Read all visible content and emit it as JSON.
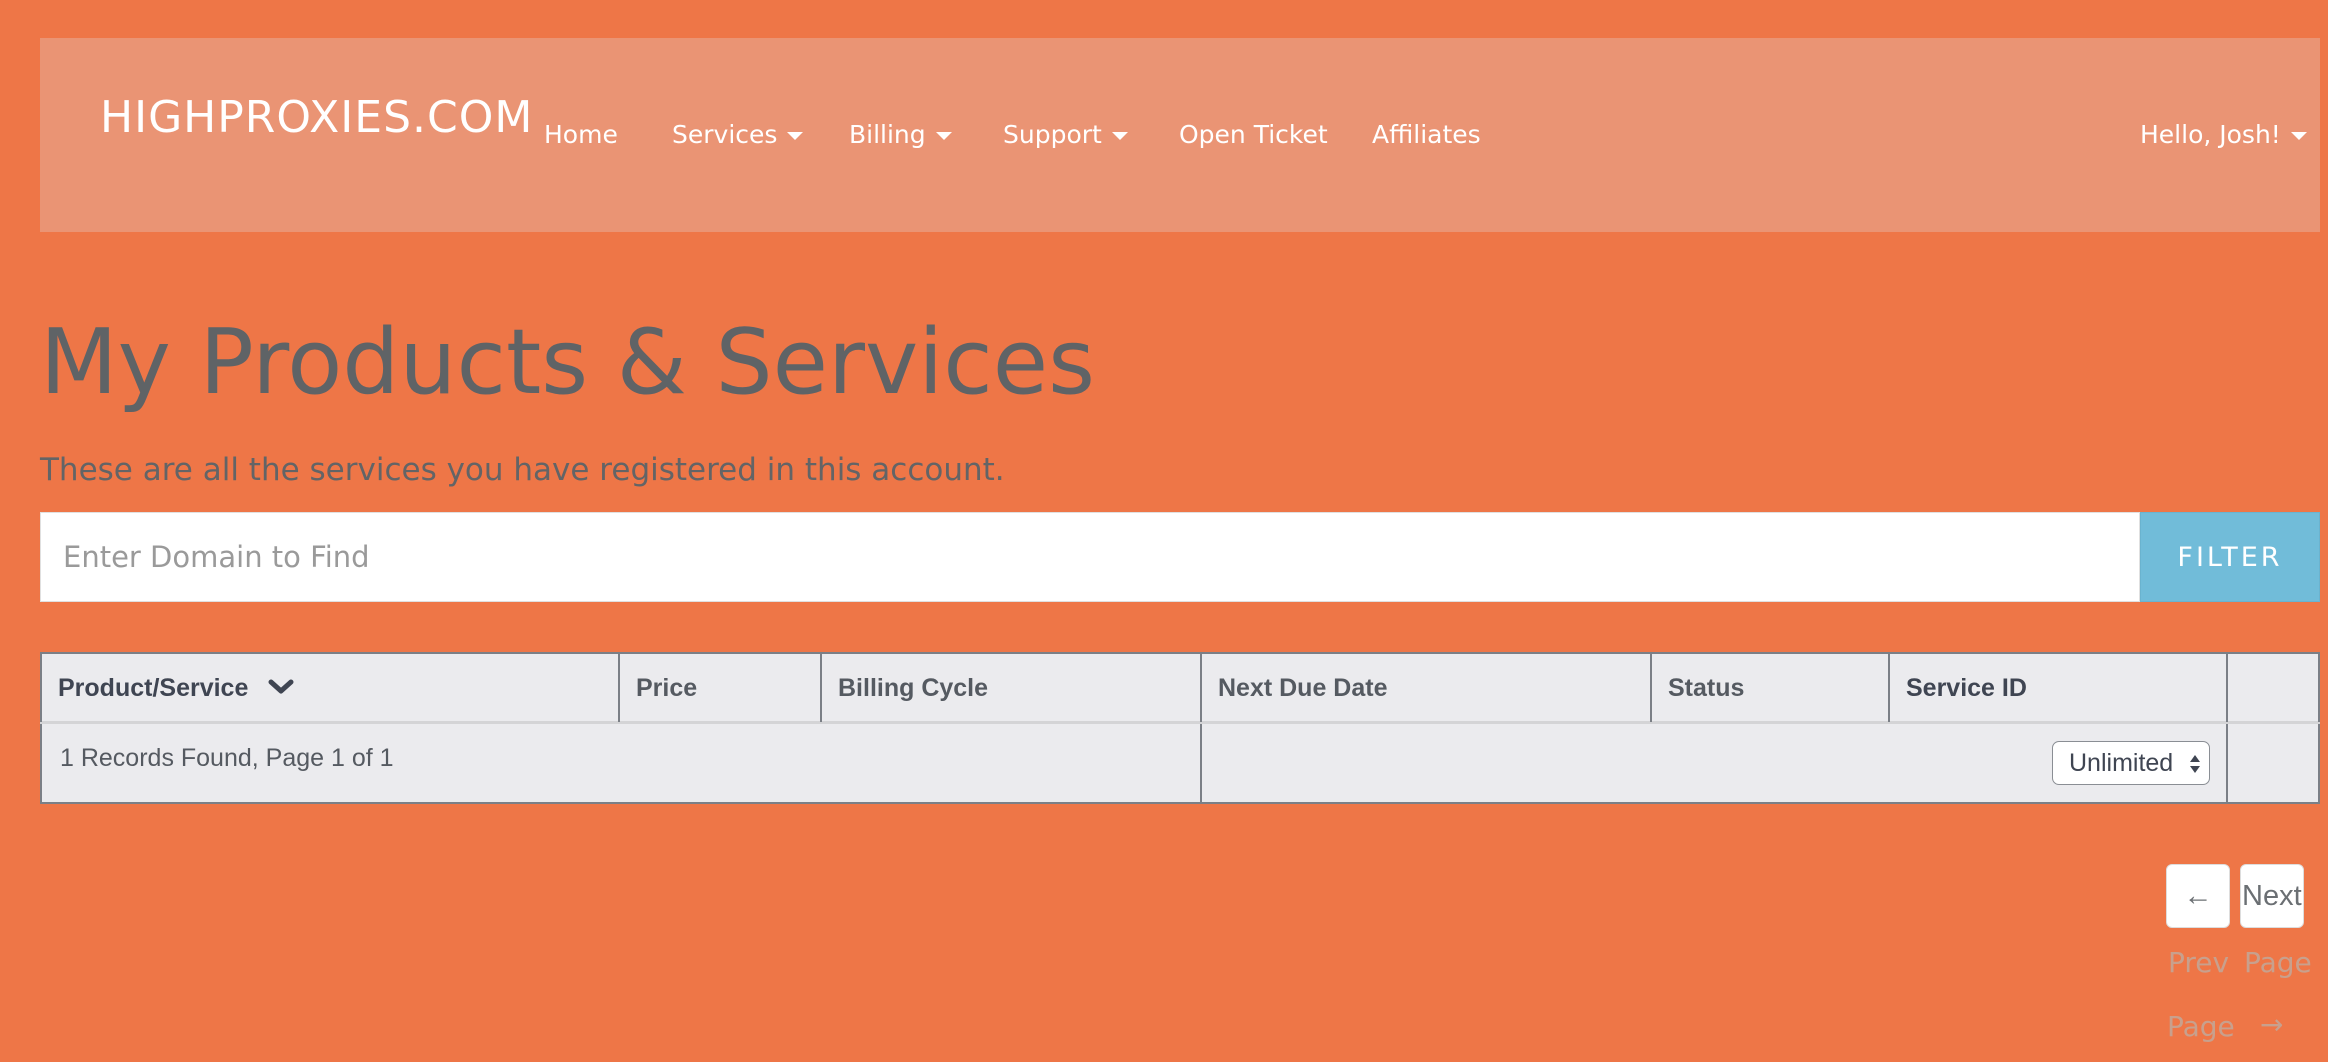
{
  "header": {
    "brand": "HIGHPROXIES.COM",
    "nav": [
      {
        "label": "Home",
        "dropdown": false
      },
      {
        "label": "Services",
        "dropdown": true
      },
      {
        "label": "Billing",
        "dropdown": true
      },
      {
        "label": "Support",
        "dropdown": true
      },
      {
        "label": "Open Ticket",
        "dropdown": false
      },
      {
        "label": "Affiliates",
        "dropdown": false
      }
    ],
    "user_menu": "Hello, Josh!"
  },
  "main": {
    "title": "My Products & Services",
    "subtitle": "These are all the services you have registered in this account.",
    "search": {
      "placeholder": "Enter Domain to Find",
      "value": ""
    },
    "filter_label": "FILTER"
  },
  "table": {
    "columns": [
      "Product/Service",
      "Price",
      "Billing Cycle",
      "Next Due Date",
      "Status",
      "Service ID"
    ],
    "sorted_column": "Product/Service",
    "records_info": "1 Records Found, Page 1 of 1",
    "length_select": "Unlimited"
  },
  "pagination": {
    "prev_symbol": "←",
    "prev_word1": "Prev",
    "prev_word2": "Page",
    "next_word1": "Next",
    "next_word2": "Page",
    "next_symbol": "→"
  },
  "colors": {
    "background": "#ee7647",
    "navbar": "#ea9474",
    "filter_button": "#71bcd9",
    "table_bg": "#ebebee"
  }
}
